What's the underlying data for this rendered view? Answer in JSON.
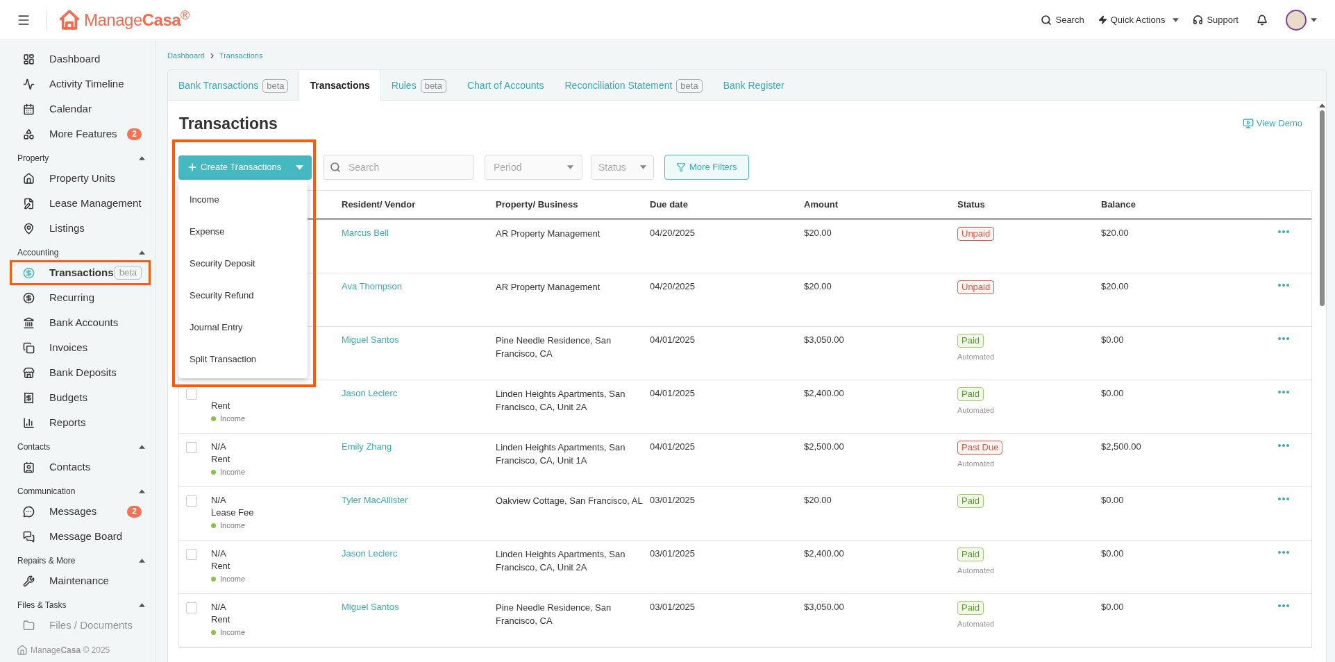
{
  "header": {
    "logo": "Manage**Casa**$^{®}$",
    "search": "Search",
    "quick_actions": "Quick Actions",
    "support": "Support"
  },
  "sidebar": {
    "top_items": [
      {
        "label": "Dashboard",
        "selected": false
      },
      {
        "label": "Activity Timeline",
        "selected": false
      },
      {
        "label": "Calendar",
        "selected": false
      },
      {
        "label": "More Features",
        "selected": false,
        "badge": "2"
      }
    ],
    "sections": [
      {
        "title": "Property",
        "expanded": true,
        "items": [
          {
            "label": "Property Units",
            "selected": false
          },
          {
            "label": "Lease Management",
            "selected": false
          },
          {
            "label": "Listings",
            "selected": false
          }
        ]
      },
      {
        "title": "Accounting",
        "expanded": true,
        "items": [
          {
            "label": "Transactions",
            "selected": true,
            "tag": "beta",
            "highlighted": true
          },
          {
            "label": "Recurring",
            "selected": false
          },
          {
            "label": "Bank Accounts",
            "selected": false
          },
          {
            "label": "Invoices",
            "selected": false
          },
          {
            "label": "Bank Deposits",
            "selected": false
          },
          {
            "label": "Budgets",
            "selected": false
          },
          {
            "label": "Reports",
            "selected": false
          }
        ]
      },
      {
        "title": "Contacts",
        "expanded": true,
        "items": [
          {
            "label": "Contacts",
            "selected": false
          }
        ]
      },
      {
        "title": "Communication",
        "expanded": true,
        "items": [
          {
            "label": "Messages",
            "selected": false,
            "badge": "2"
          },
          {
            "label": "Message Board",
            "selected": false
          }
        ]
      },
      {
        "title": "Repairs & More",
        "expanded": true,
        "items": [
          {
            "label": "Maintenance",
            "selected": false
          }
        ]
      },
      {
        "title": "Files & Tasks",
        "expanded": true,
        "items": [
          {
            "label": "Files / Documents",
            "selected": false,
            "dimmed": true
          }
        ]
      }
    ],
    "footer": "Manage**Casa** © 2025"
  },
  "breadcrumb": [
    "Dashboard",
    "Transactions"
  ],
  "tabs": [
    {
      "label": "Bank Transactions",
      "selected": false,
      "tag": "beta"
    },
    {
      "label": "Transactions",
      "selected": true
    },
    {
      "label": "Rules",
      "selected": false,
      "tag": "beta"
    },
    {
      "label": "Chart of Accounts",
      "selected": false
    },
    {
      "label": "Reconciliation Statement",
      "selected": false,
      "tag": "beta"
    },
    {
      "label": "Bank Register",
      "selected": false
    }
  ],
  "page": {
    "title": "Transactions",
    "view_demo": "View Demo"
  },
  "create_menu": {
    "label": "Create Transactions",
    "expanded": true,
    "highlighted": true,
    "items": [
      "Income",
      "Expense",
      "Security Deposit",
      "Security Refund",
      "Journal Entry",
      "Split Transaction"
    ]
  },
  "filters": {
    "search_placeholder": "Search",
    "period_placeholder": "Period",
    "status_placeholder": "Status",
    "more_filters": "More Filters"
  },
  "table": {
    "columns": [
      "Resident/ Vendor",
      "Property/ Business",
      "Due date",
      "Amount",
      "Status",
      "Balance"
    ],
    "rows": [
      {
        "resident": "Marcus Bell",
        "property": "AR Property Management",
        "due_date": "04/20/2025",
        "amount": "$20.00",
        "status": {
          "label": "Unpaid",
          "kind": "negative"
        },
        "balance": "$20.00"
      },
      {
        "resident": "Ava Thompson",
        "property": "AR Property Management",
        "due_date": "04/20/2025",
        "amount": "$20.00",
        "status": {
          "label": "Unpaid",
          "kind": "negative"
        },
        "balance": "$20.00"
      },
      {
        "resident": "Miguel Santos",
        "property": "Pine Needle Residence, San Francisco, CA",
        "due_date": "04/01/2025",
        "amount": "$3,050.00",
        "status": {
          "label": "Paid",
          "kind": "positive"
        },
        "note": "Automated",
        "balance": "$0.00"
      },
      {
        "checked": false,
        "category": "Rent",
        "type": "Income",
        "resident": "Jason Leclerc",
        "property": "Linden Heights Apartments, San Francisco, CA, Unit 2A",
        "due_date": "04/01/2025",
        "amount": "$2,400.00",
        "status": {
          "label": "Paid",
          "kind": "positive"
        },
        "note": "Automated",
        "balance": "$0.00"
      },
      {
        "checked": false,
        "reference": "N/A",
        "category": "Rent",
        "type": "Income",
        "resident": "Emily Zhang",
        "property": "Linden Heights Apartments, San Francisco, CA, Unit 1A",
        "due_date": "04/01/2025",
        "amount": "$2,500.00",
        "status": {
          "label": "Past Due",
          "kind": "negative"
        },
        "note": "Automated",
        "balance": "$2,500.00"
      },
      {
        "checked": false,
        "reference": "N/A",
        "category": "Lease Fee",
        "type": "Income",
        "resident": "Tyler MacAllister",
        "property": "Oakview Cottage, San Francisco, AL",
        "due_date": "03/01/2025",
        "amount": "$20.00",
        "status": {
          "label": "Paid",
          "kind": "positive"
        },
        "balance": "$0.00"
      },
      {
        "checked": false,
        "reference": "N/A",
        "category": "Rent",
        "type": "Income",
        "resident": "Jason Leclerc",
        "property": "Linden Heights Apartments, San Francisco, CA, Unit 2A",
        "due_date": "03/01/2025",
        "amount": "$2,400.00",
        "status": {
          "label": "Paid",
          "kind": "positive"
        },
        "note": "Automated",
        "balance": "$0.00"
      },
      {
        "checked": false,
        "reference": "N/A",
        "category": "Rent",
        "type": "Income",
        "resident": "Miguel Santos",
        "property": "Pine Needle Residence, San Francisco, CA",
        "due_date": "03/01/2025",
        "amount": "$3,050.00",
        "status": {
          "label": "Paid",
          "kind": "positive"
        },
        "note": "Automated",
        "balance": "$0.00"
      }
    ]
  }
}
